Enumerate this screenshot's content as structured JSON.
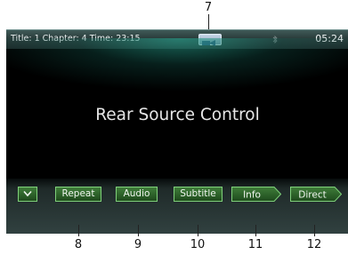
{
  "callouts": {
    "top": "7",
    "bottom": [
      "8",
      "9",
      "10",
      "11",
      "12"
    ]
  },
  "status_bar": {
    "info": "Title: 1 Chapter: 4 Time: 23:15",
    "clock": "05:24",
    "icons": [
      "av-source-icon",
      "bluetooth-icon"
    ]
  },
  "main": {
    "title": "Rear Source Control"
  },
  "buttons": {
    "down": "chevron-down-icon",
    "repeat": "Repeat",
    "audio": "Audio",
    "subtitle": "Subtitle",
    "info": "Info",
    "direct": "Direct"
  },
  "colors": {
    "button_border": "#7fd07a",
    "button_fill": "#2d6329",
    "screen_bg": "#000000"
  }
}
